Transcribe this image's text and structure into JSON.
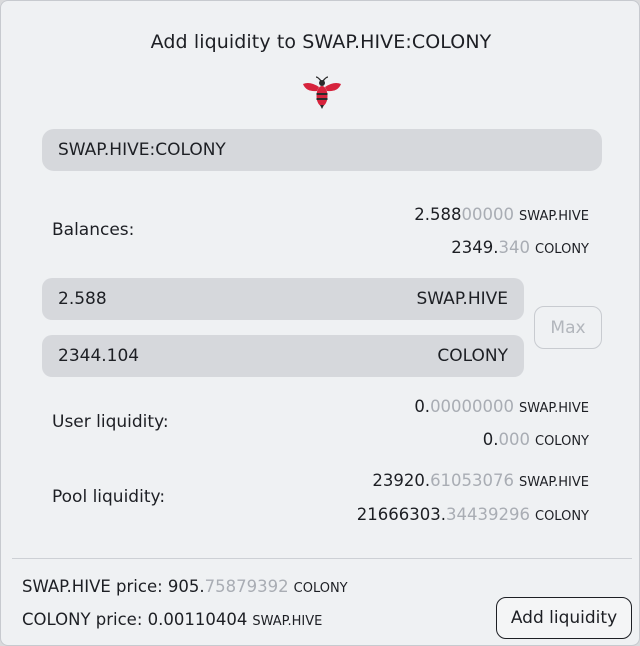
{
  "dialog": {
    "title": "Add liquidity to SWAP.HIVE:COLONY",
    "logo_icon": "hive-bee-icon",
    "pair_value": "SWAP.HIVE:COLONY",
    "max_label": "Max",
    "add_label": "Add liquidity"
  },
  "balances": {
    "label": "Balances:",
    "swap_hive": {
      "main": "2.588",
      "dim": "00000",
      "unit": "SWAP.HIVE"
    },
    "colony": {
      "main": "2349.",
      "dim": "340",
      "unit": "COLONY"
    }
  },
  "inputs": {
    "swap_hive": {
      "value": "2.588",
      "unit": "SWAP.HIVE"
    },
    "colony": {
      "value": "2344.104",
      "unit": "COLONY"
    }
  },
  "user_liquidity": {
    "label": "User liquidity:",
    "swap_hive": {
      "main": "0.",
      "dim": "00000000",
      "unit": "SWAP.HIVE"
    },
    "colony": {
      "main": "0.",
      "dim": "000",
      "unit": "COLONY"
    }
  },
  "pool_liquidity": {
    "label": "Pool liquidity:",
    "swap_hive": {
      "main": "23920.",
      "dim": "61053076",
      "unit": "SWAP.HIVE"
    },
    "colony": {
      "main": "21666303.",
      "dim": "34439296",
      "unit": "COLONY"
    }
  },
  "prices": {
    "swap_hive": {
      "label": "SWAP.HIVE price: ",
      "main": "905.",
      "dim": "75879392",
      "unit": "COLONY"
    },
    "colony": {
      "label": "COLONY price: ",
      "main": "0.00110404",
      "dim": "",
      "unit": "SWAP.HIVE"
    }
  },
  "colors": {
    "accent": "#d6233c",
    "field_bg": "#d6d8dc",
    "muted_digits": "#a9adb4"
  }
}
